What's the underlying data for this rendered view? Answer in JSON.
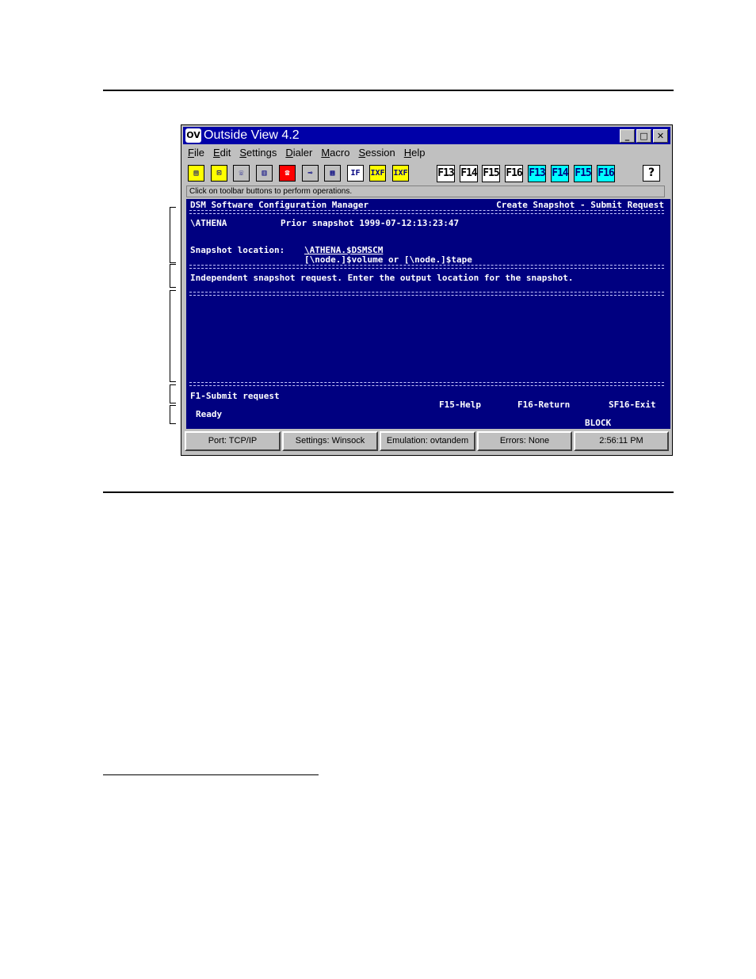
{
  "window": {
    "icon_text": "OV",
    "title": "Outside View 4.2",
    "controls": {
      "minimize": "_",
      "maximize": "□",
      "close": "✕"
    }
  },
  "menu": [
    "File",
    "Edit",
    "Settings",
    "Dialer",
    "Macro",
    "Session",
    "Help"
  ],
  "toolbar": {
    "icons": [
      {
        "name": "print-icon",
        "glyph": "▤",
        "bg": "#ffff00"
      },
      {
        "name": "open-icon",
        "glyph": "⊡",
        "bg": "#ffff00"
      },
      {
        "name": "phone-handset-icon",
        "glyph": "☏",
        "bg": "#c0c0c0"
      },
      {
        "name": "phonebook-icon",
        "glyph": "▥",
        "bg": "#c0c0c0"
      },
      {
        "name": "telephone-icon",
        "glyph": "☎",
        "bg": "#ff0000"
      },
      {
        "name": "connect-icon",
        "glyph": "⊸",
        "bg": "#c0c0c0"
      },
      {
        "name": "keypad-icon",
        "glyph": "▦",
        "bg": "#c0c0c0"
      },
      {
        "name": "file-transfer-icon",
        "glyph": "IF",
        "bg": "#ffffff"
      },
      {
        "name": "ixf-icon",
        "glyph": "IXF",
        "bg": "#ffff00"
      },
      {
        "name": "ixf-receive-icon",
        "glyph": "IXF",
        "bg": "#ffff00"
      }
    ],
    "fkeys": [
      "F13",
      "F14",
      "F15",
      "F16",
      "F13",
      "F14",
      "F15",
      "F16"
    ],
    "help_label": "?",
    "hint": "Click on toolbar buttons to perform operations."
  },
  "terminal": {
    "header_left": "DSM Software Configuration Manager",
    "header_right": "Create Snapshot - Submit Request",
    "node": "\\ATHENA",
    "prior_snapshot": "Prior snapshot 1999-07-12:13:23:47",
    "location_label": "Snapshot location:",
    "location_value": "\\ATHENA.$DSMSCM",
    "location_hint": "[\\node.]$volume or [\\node.]$tape",
    "message": "Independent snapshot request. Enter the output location for the snapshot.",
    "fkey_f1": "F1-Submit request",
    "fkey_f15": "F15-Help",
    "fkey_f16": "F16-Return",
    "fkey_sf16": "SF16-Exit",
    "status": "Ready",
    "mode": "BLOCK"
  },
  "statusbar": {
    "port": "Port: TCP/IP",
    "settings": "Settings: Winsock",
    "emulation": "Emulation: ovtandem",
    "errors": "Errors: None",
    "time": "2:56:11 PM"
  },
  "colors": {
    "titlebar": "#0000a8",
    "terminal_bg": "#000080",
    "terminal_text": "#ffffff",
    "chrome": "#c0c0c0",
    "fkey_cyan": "#00ffff"
  }
}
